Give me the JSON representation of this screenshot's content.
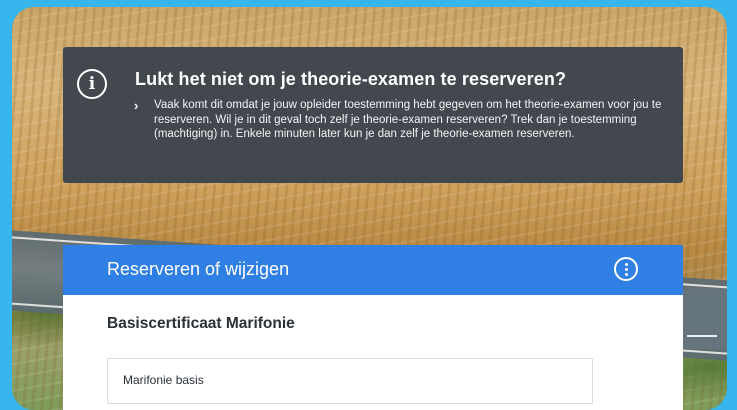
{
  "banner": {
    "icon": "info-icon",
    "title": "Lukt het niet om je theorie-examen te reserveren?",
    "chevron": "›",
    "body": "Vaak komt dit omdat je jouw opleider toestemming hebt gegeven om het theorie-examen voor jou te reserveren. Wil je in dit geval toch zelf je theorie-examen reserveren? Trek dan je toestemming (machtiging) in. Enkele minuten later kun je dan zelf je theorie-examen reserveren."
  },
  "card": {
    "header_title": "Reserveren of wijzigen",
    "header_icon": "more-options-icon",
    "subtitle": "Basiscertificaat Marifonie",
    "field_value": "Marifonie basis"
  },
  "colors": {
    "frame_border": "#36b6ec",
    "banner_bg": "#3a424c",
    "card_header": "#2f7fe5"
  }
}
